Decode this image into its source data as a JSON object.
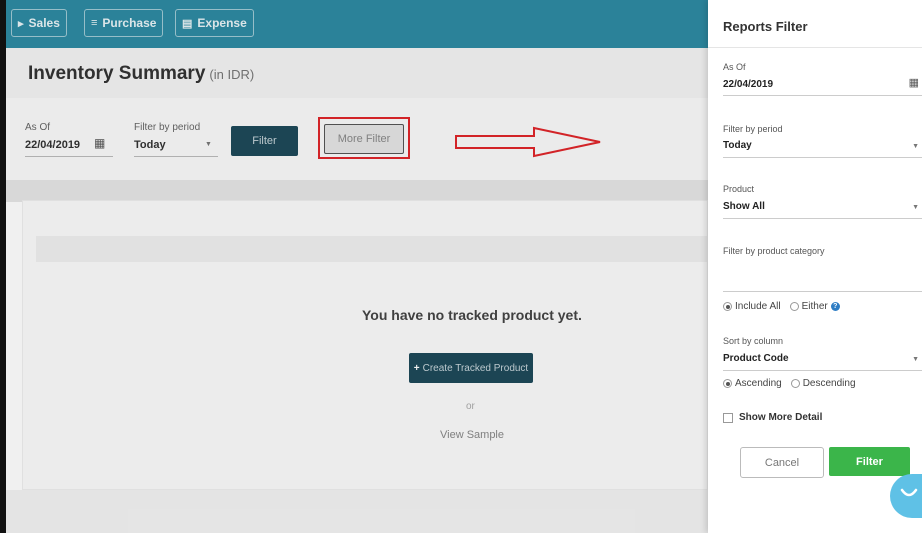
{
  "nav": {
    "sales": "Sales",
    "purchase": "Purchase",
    "expense": "Expense"
  },
  "page": {
    "title": "Inventory Summary",
    "currency": "(in IDR)"
  },
  "filters": {
    "as_of_label": "As Of",
    "as_of_value": "22/04/2019",
    "period_label": "Filter by period",
    "period_value": "Today",
    "filter_button": "Filter",
    "more_filter_button": "More Filter"
  },
  "empty_state": {
    "message": "You have no tracked product yet.",
    "create_button": "Create Tracked Product",
    "or": "or",
    "view_sample": "View Sample"
  },
  "panel": {
    "title": "Reports Filter",
    "as_of_label": "As Of",
    "as_of_value": "22/04/2019",
    "period_label": "Filter by period",
    "period_value": "Today",
    "product_label": "Product",
    "product_value": "Show All",
    "category_label": "Filter by product category",
    "include_all": "Include All",
    "either": "Either",
    "sort_label": "Sort by column",
    "sort_value": "Product Code",
    "ascending": "Ascending",
    "descending": "Descending",
    "show_more_detail": "Show More Detail",
    "cancel_button": "Cancel",
    "filter_button": "Filter"
  },
  "icons": {
    "sales": "tag-icon",
    "purchase": "card-icon",
    "expense": "receipt-icon",
    "calendar": "calendar-icon",
    "help": "help-icon",
    "chat": "chat-icon"
  },
  "colors": {
    "topbar": "#2e8ba3",
    "primary_dark": "#1e4a5a",
    "apply_green": "#3bb54a",
    "highlight_red": "#e0262a",
    "chat_blue": "#5fc1e6"
  }
}
